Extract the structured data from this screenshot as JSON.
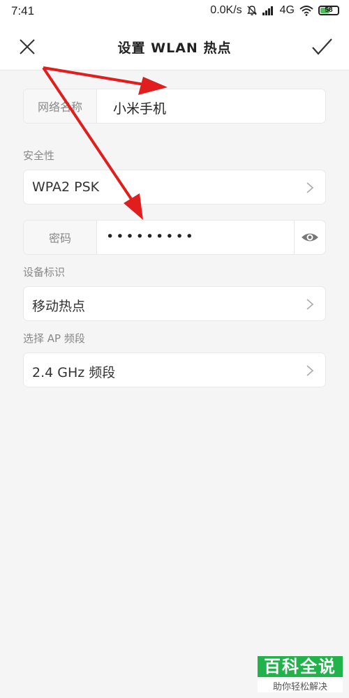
{
  "statusbar": {
    "time": "7:41",
    "net_speed": "0.0K/s",
    "network_type": "4G",
    "battery": "58",
    "battery_fraction": 0.58
  },
  "titlebar": {
    "title": "设置 WLAN 热点",
    "close_icon": "close-icon",
    "confirm_icon": "check-icon"
  },
  "form": {
    "network_name": {
      "label": "网络名称",
      "value": "小米手机"
    },
    "security": {
      "section_label": "安全性",
      "value": "WPA2 PSK"
    },
    "password": {
      "label": "密码",
      "value": "•••••••••"
    },
    "device_id": {
      "section_label": "设备标识",
      "value": "移动热点"
    },
    "ap_band": {
      "section_label": "选择 AP 频段",
      "value": "2.4 GHz 频段"
    }
  },
  "watermark": {
    "logo": "百科全说",
    "tagline": "助你轻松解决"
  },
  "colors": {
    "annotation_arrow": "#e01e1e",
    "watermark_green": "#21b24b",
    "background": "#f5f5f5"
  }
}
